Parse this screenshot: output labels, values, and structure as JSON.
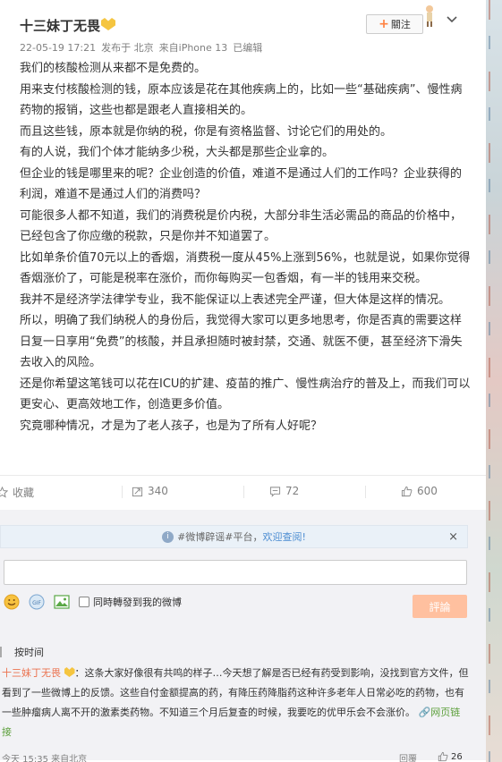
{
  "post": {
    "author": "十三妹丁无畏",
    "date": "22-05-19 17:21",
    "source_prefix": "发布于 北京",
    "client": "来自iPhone 13",
    "edited": "已编辑",
    "follow_label": "關注",
    "paragraphs": [
      "我们的核酸检测从来都不是免费的。",
      "用来支付核酸检测的钱，原本应该是花在其他疾病上的，比如一些“基础疾病”、慢性病药物的报销，这些也都是跟老人直接相关的。",
      "而且这些钱，原本就是你纳的税，你是有资格监督、讨论它们的用处的。",
      "有的人说，我们个体才能纳多少税，大头都是那些企业拿的。",
      "但企业的钱是哪里来的呢？企业创造的价值，难道不是通过人们的工作吗？企业获得的利润，难道不是通过人们的消费吗？",
      "可能很多人都不知道，我们的消费税是价内税，大部分非生活必需品的商品的价格中，已经包含了你应缴的税款，只是你并不知道罢了。",
      "比如单条价值70元以上的香烟，消费税一度从45%上涨到56%，也就是说，如果你觉得香烟涨价了，可能是税率在涨价，而你每购买一包香烟，有一半的钱用来交税。",
      "我并不是经济学法律学专业，我不能保证以上表述完全严谨，但大体是这样的情况。",
      "所以，明确了我们纳税人的身份后，我觉得大家可以更多地思考，你是否真的需要这样日复一日享用“免费”的核酸，并且承担随时被封禁，交通、就医不便，甚至经济下滑失去收入的风险。",
      "还是你希望这笔钱可以花在ICU的扩建、疫苗的推广、慢性病治疗的普及上，而我们可以更安心、更高效地工作，创造更多价值。",
      "究竟哪种情况，才是为了老人孩子，也是为了所有人好呢？"
    ]
  },
  "actions": {
    "favorite_label": "收藏",
    "repost_count": "340",
    "comment_count": "72",
    "like_count": "600"
  },
  "comment_box": {
    "notice_prefix": "#微博辟谣#平台，",
    "notice_highlight": "欢迎查阅!",
    "notice_close": "×",
    "repost_label": "同時轉發到我的微博",
    "submit_label": "評論",
    "sort_label": "按时间"
  },
  "comments": [
    {
      "author": "十三妹丁无畏",
      "text": "：这条大家好像很有共鸣的样子…今天想了解是否已经有药受到影响，没找到官方文件，但看到了一些微博上的反馈。这些自付金额提高的药，有降压药降脂药这种许多老年人日常必吃的药物，也有一些肿瘤病人离不开的激素类药物。不知道三个月后复查的时候，我要吃的优甲乐会不会涨价。",
      "link": "网页链接",
      "time": "今天 15:35 来自北京",
      "reply_label": "回覆",
      "like_count": "26"
    }
  ],
  "icons": {
    "favorite": "star-outline-icon",
    "repost": "repost-icon",
    "comment": "comment-bubble-icon",
    "like": "thumbs-up-icon",
    "emoji": "emoji-icon",
    "gif": "gif-icon",
    "image": "image-icon",
    "info": "info-icon",
    "chevron": "chevron-down-icon",
    "link": "link-icon"
  },
  "colors": {
    "accent_orange": "#ff8140",
    "vip_gold": "#f5c540",
    "comment_author": "#eb7350",
    "link_green": "#5c9f3b",
    "notice_blue": "#4e8ed2",
    "submit_disabled": "#ffc09f"
  }
}
